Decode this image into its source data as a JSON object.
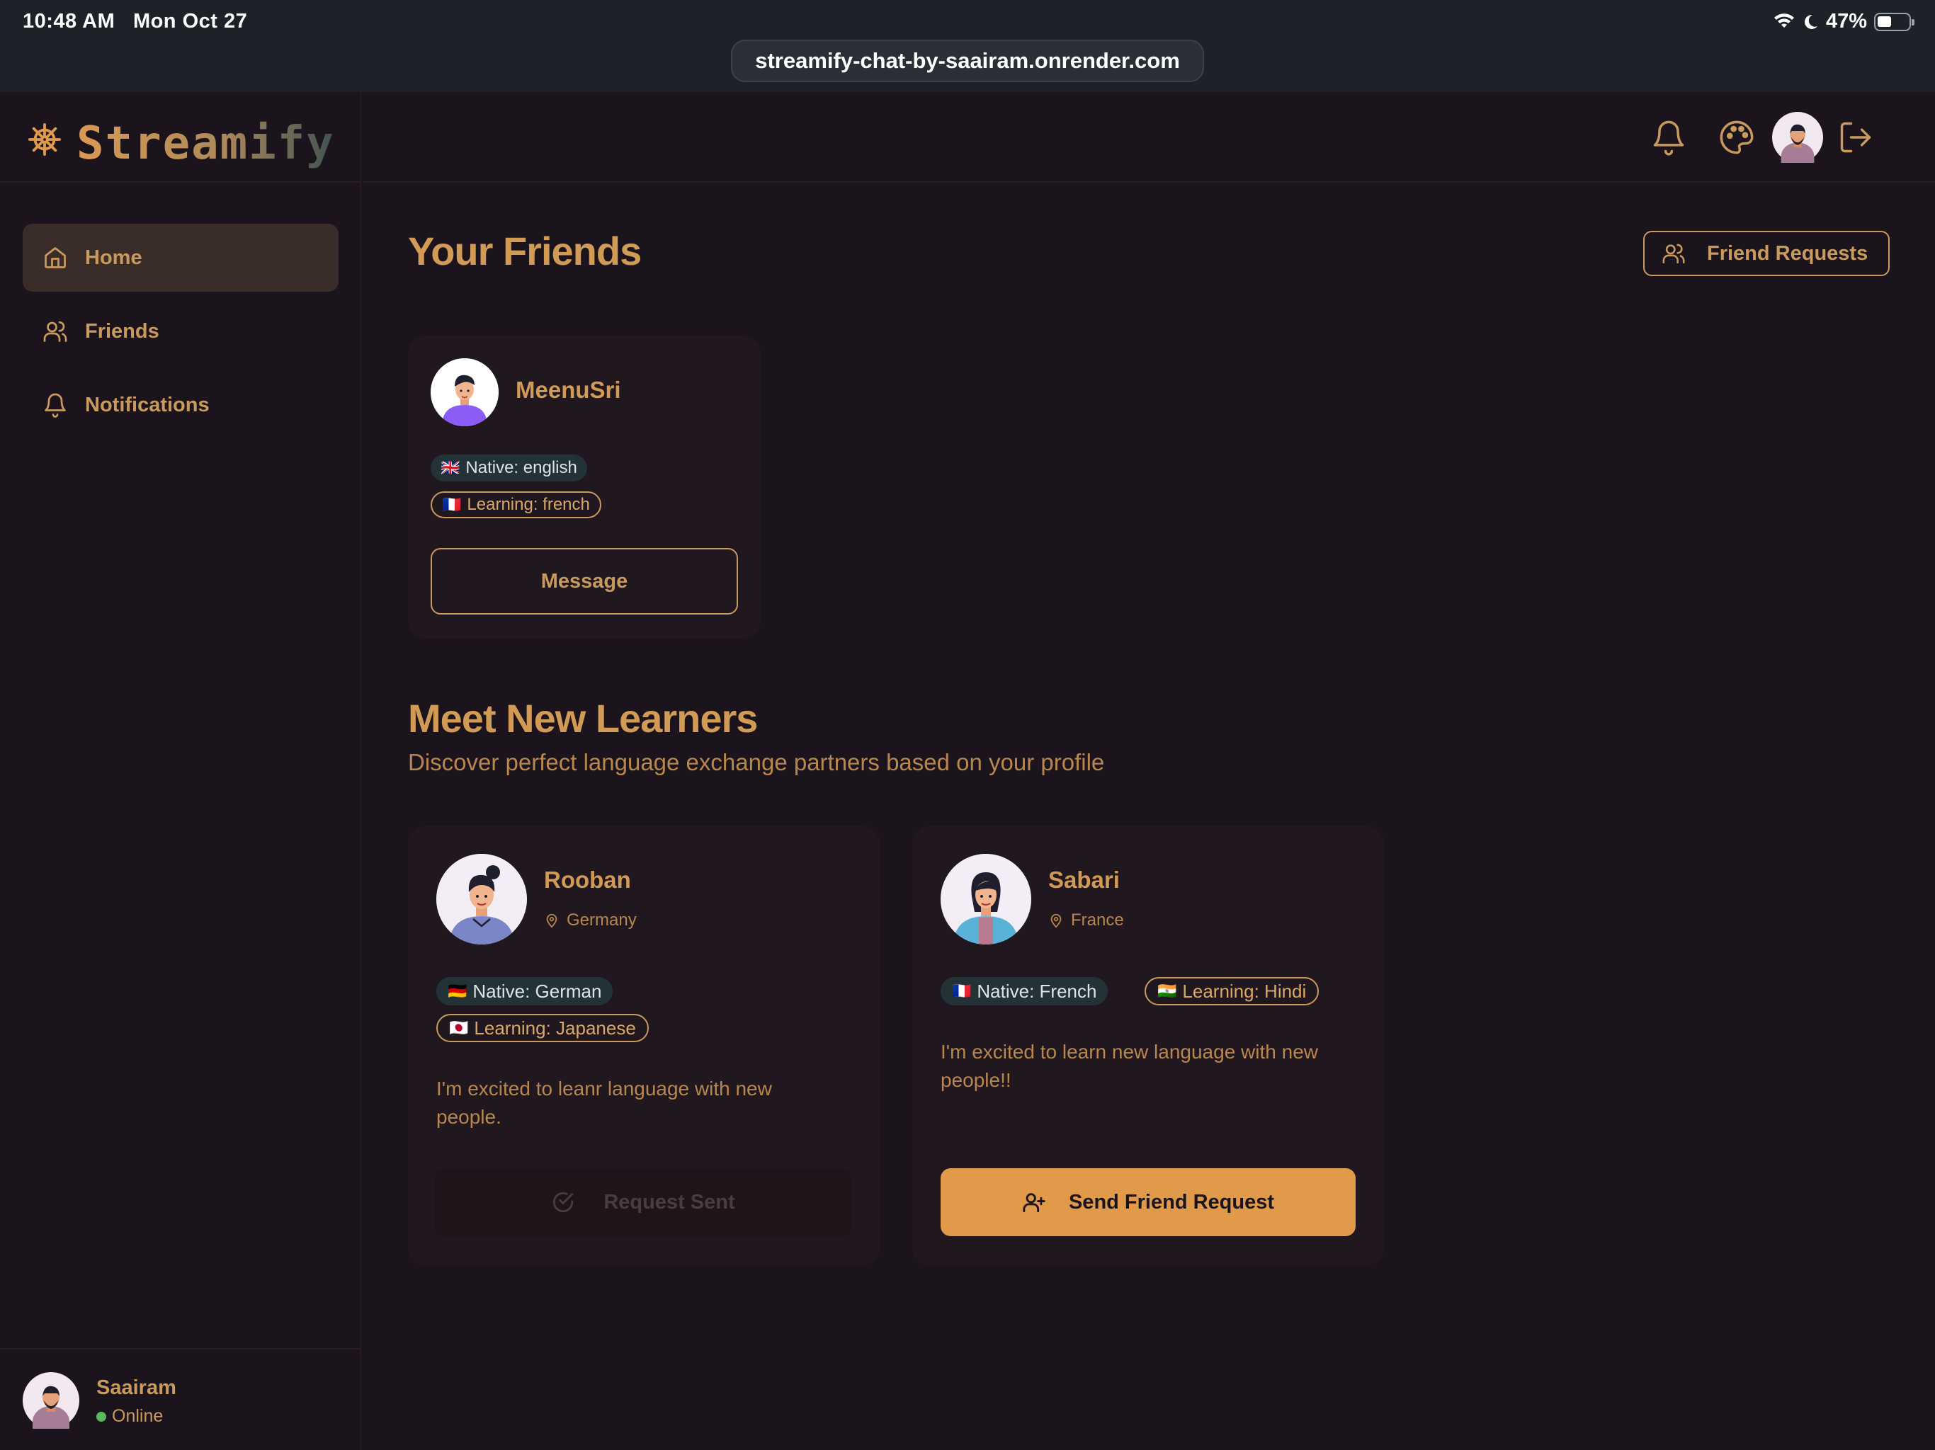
{
  "status_bar": {
    "time": "10:48 AM",
    "date": "Mon Oct 27",
    "battery": "47%"
  },
  "browser": {
    "url": "streamify-chat-by-saairam.onrender.com"
  },
  "brand": {
    "name": "Streamify",
    "icon": "ship-wheel-icon"
  },
  "sidebar": {
    "items": [
      {
        "label": "Home",
        "icon": "home-icon",
        "active": true
      },
      {
        "label": "Friends",
        "icon": "users-icon",
        "active": false
      },
      {
        "label": "Notifications",
        "icon": "bell-icon",
        "active": false
      }
    ],
    "user": {
      "name": "Saairam",
      "status": "Online"
    }
  },
  "header": {
    "icons": [
      "bell-icon",
      "palette-icon",
      "avatar",
      "logout-icon"
    ]
  },
  "friends_section": {
    "title": "Your Friends",
    "friend_requests_label": "Friend Requests",
    "friends": [
      {
        "name": "MeenuSri",
        "native": "Native: english",
        "native_flag": "🇬🇧",
        "learning": "Learning: french",
        "learning_flag": "🇫🇷",
        "message_label": "Message"
      }
    ]
  },
  "learners_section": {
    "title": "Meet New Learners",
    "subtitle": "Discover perfect language exchange partners based on your profile",
    "learners": [
      {
        "name": "Rooban",
        "location": "Germany",
        "native": "Native: German",
        "native_flag": "🇩🇪",
        "learning": "Learning: Japanese",
        "learning_flag": "🇯🇵",
        "bio": "I'm excited to leanr language with new people.",
        "action_label": "Request Sent",
        "action_state": "sent"
      },
      {
        "name": "Sabari",
        "location": "France",
        "native": "Native: French",
        "native_flag": "🇫🇷",
        "learning": "Learning: Hindi",
        "learning_flag": "🇮🇳",
        "bio": "I'm excited to learn new language with new people!!",
        "action_label": "Send Friend Request",
        "action_state": "available"
      }
    ]
  },
  "colors": {
    "background": "#1c141d",
    "accent": "#e09a4a",
    "text_gold": "#c99a5e",
    "active_nav": "#3a2c28",
    "native_badge": "#223237",
    "online": "#5cb85c"
  }
}
